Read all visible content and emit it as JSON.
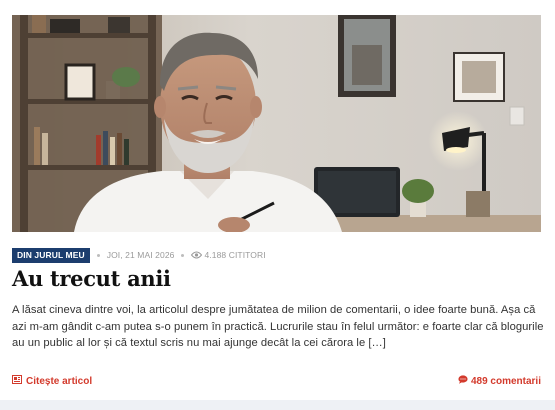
{
  "article": {
    "category": "DIN JURUL MEU",
    "date": "JOI, 21 MAI 2026",
    "views": "4.188 CITITORI",
    "title": "Au trecut anii",
    "excerpt": "A lăsat cineva dintre voi, la articolul despre jumătatea de milion de comentarii, o idee foarte bună. Așa că azi m-am gândit c-am putea s-o punem în practică. Lucrurile stau în felul următor: e foarte clar că blogurile au un public al lor și că textul scris nu mai ajunge decât la cei cărora le […]",
    "read_more_label": "Citește articol",
    "comments_label": "489 comentarii"
  },
  "colors": {
    "badge": "#1c3d6e",
    "accent": "#d33a2c"
  },
  "icons": {
    "views": "eye-icon",
    "read_more": "article-icon",
    "comments": "comment-bubble-icon"
  }
}
